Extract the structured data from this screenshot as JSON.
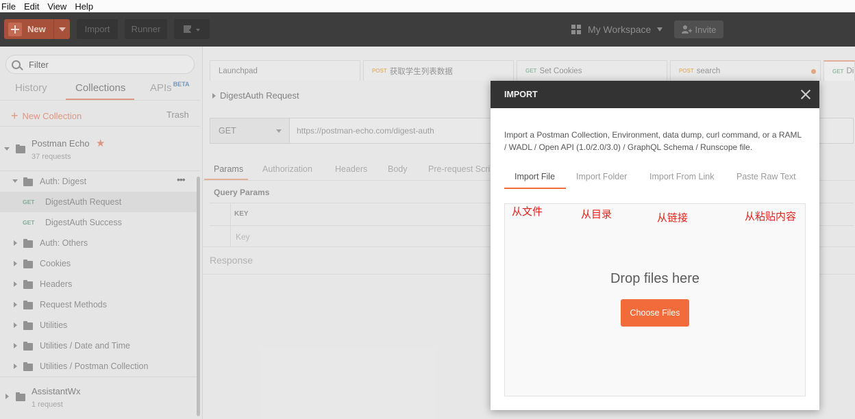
{
  "menubar": {
    "items": [
      "File",
      "Edit",
      "View",
      "Help"
    ]
  },
  "toolbar": {
    "new_label": "New",
    "import_label": "Import",
    "runner_label": "Runner",
    "workspace_label": "My Workspace",
    "invite_label": "Invite"
  },
  "sidebar": {
    "filter_placeholder": "Filter",
    "tabs": {
      "history": "History",
      "collections": "Collections",
      "apis": "APIs",
      "apis_badge": "BETA"
    },
    "new_collection": "New Collection",
    "trash": "Trash",
    "collections": [
      {
        "name": "Postman Echo",
        "count": "37 requests"
      },
      {
        "name": "AssistantWx",
        "count": "1 request"
      }
    ],
    "tree": [
      {
        "label": "Auth: Digest"
      },
      {
        "method": "GET",
        "label": "DigestAuth Request"
      },
      {
        "method": "GET",
        "label": "DigestAuth Success"
      },
      {
        "label": "Auth: Others"
      },
      {
        "label": "Cookies"
      },
      {
        "label": "Headers"
      },
      {
        "label": "Request Methods"
      },
      {
        "label": "Utilities"
      },
      {
        "label": "Utilities / Date and Time"
      },
      {
        "label": "Utilities / Postman Collection"
      }
    ],
    "more": "•••"
  },
  "request_tabs": [
    {
      "method": "",
      "label": "Launchpad"
    },
    {
      "method": "POST",
      "label": "获取学生列表数据"
    },
    {
      "method": "GET",
      "label": "Set Cookies"
    },
    {
      "method": "POST",
      "label": "search"
    },
    {
      "method": "GET",
      "label": "Di"
    }
  ],
  "request": {
    "name": "DigestAuth Request",
    "method": "GET",
    "url": "https://postman-echo.com/digest-auth",
    "param_tabs": [
      "Params",
      "Authorization",
      "Headers",
      "Body",
      "Pre-request Scri"
    ],
    "query_params_label": "Query Params",
    "key_header": "KEY",
    "key_placeholder": "Key",
    "response_label": "Response"
  },
  "modal": {
    "title": "IMPORT",
    "description": "Import a Postman Collection, Environment, data dump, curl command, or a RAML / WADL / Open API (1.0/2.0/3.0) / GraphQL Schema / Runscope file.",
    "tabs": [
      "Import File",
      "Import Folder",
      "Import From Link",
      "Paste Raw Text"
    ],
    "annotations": [
      "从文件",
      "从目录",
      "从链接",
      "从粘贴内容"
    ],
    "drop_text": "Drop files here",
    "choose_button": "Choose Files"
  },
  "colors": {
    "accent": "#f26b3a",
    "annotation": "#e0221a",
    "toolbar_bg": "#3d3d3d",
    "modal_header": "#333333"
  }
}
